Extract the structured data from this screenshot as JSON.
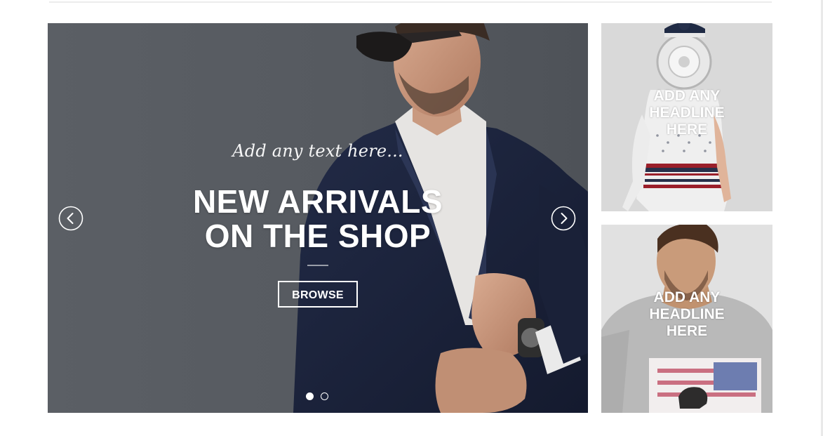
{
  "slider": {
    "script_text": "Add any text here...",
    "headline_line1": "NEW ARRIVALS",
    "headline_line2": "ON THE SHOP",
    "button_label": "BROWSE",
    "active_slide": 1,
    "slide_count": 2
  },
  "banners": [
    {
      "headline_line1": "ADD ANY",
      "headline_line2": "HEADLINE",
      "headline_line3": "HERE"
    },
    {
      "headline_line1": "ADD ANY",
      "headline_line2": "HEADLINE",
      "headline_line3": "HERE"
    }
  ],
  "icons": {
    "prev": "chevron-left-icon",
    "next": "chevron-right-icon"
  },
  "colors": {
    "slider_bg": "#575b61",
    "jacket": "#1b2440",
    "text": "#ffffff"
  }
}
